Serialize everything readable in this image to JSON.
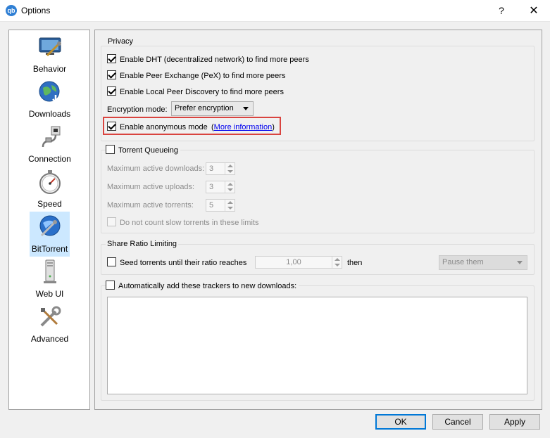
{
  "window": {
    "title": "Options",
    "app_icon_text": "qb",
    "help_label": "?",
    "close_label": "✕"
  },
  "sidebar": {
    "items": [
      {
        "label": "Behavior",
        "icon": "behavior-icon"
      },
      {
        "label": "Downloads",
        "icon": "downloads-globe-icon"
      },
      {
        "label": "Connection",
        "icon": "connection-icon"
      },
      {
        "label": "Speed",
        "icon": "speed-stopwatch-icon"
      },
      {
        "label": "BitTorrent",
        "icon": "bittorrent-icon",
        "selected": true
      },
      {
        "label": "Web UI",
        "icon": "web-ui-icon"
      },
      {
        "label": "Advanced",
        "icon": "advanced-tools-icon"
      }
    ]
  },
  "privacy": {
    "title": "Privacy",
    "dht": {
      "label": "Enable DHT (decentralized network) to find more peers",
      "checked": true
    },
    "pex": {
      "label": "Enable Peer Exchange (PeX) to find more peers",
      "checked": true
    },
    "lpd": {
      "label": "Enable Local Peer Discovery to find more peers",
      "checked": true
    },
    "encryption_label": "Encryption mode:",
    "encryption_value": "Prefer encryption",
    "anonymous": {
      "label": "Enable anonymous mode",
      "checked": true,
      "paren_open": "(",
      "link": "More information",
      "paren_close": ")"
    }
  },
  "queueing": {
    "title": "Torrent Queueing",
    "checked": false,
    "max_downloads_label": "Maximum active downloads:",
    "max_downloads": "3",
    "max_uploads_label": "Maximum active uploads:",
    "max_uploads": "3",
    "max_torrents_label": "Maximum active torrents:",
    "max_torrents": "5",
    "slow_label": "Do not count slow torrents in these limits"
  },
  "ratio": {
    "title": "Share Ratio Limiting",
    "seed_label": "Seed torrents until their ratio reaches",
    "seed_checked": false,
    "value": "1,00",
    "then_label": "then",
    "action": "Pause them"
  },
  "trackers": {
    "label": "Automatically add these trackers to new downloads:",
    "checked": false
  },
  "buttons": {
    "ok": "OK",
    "cancel": "Cancel",
    "apply": "Apply"
  },
  "colors": {
    "highlight_box": "#d9443f",
    "selected_bg": "#cce8ff",
    "default_button_border": "#0078d7",
    "link": "#0000ee"
  }
}
